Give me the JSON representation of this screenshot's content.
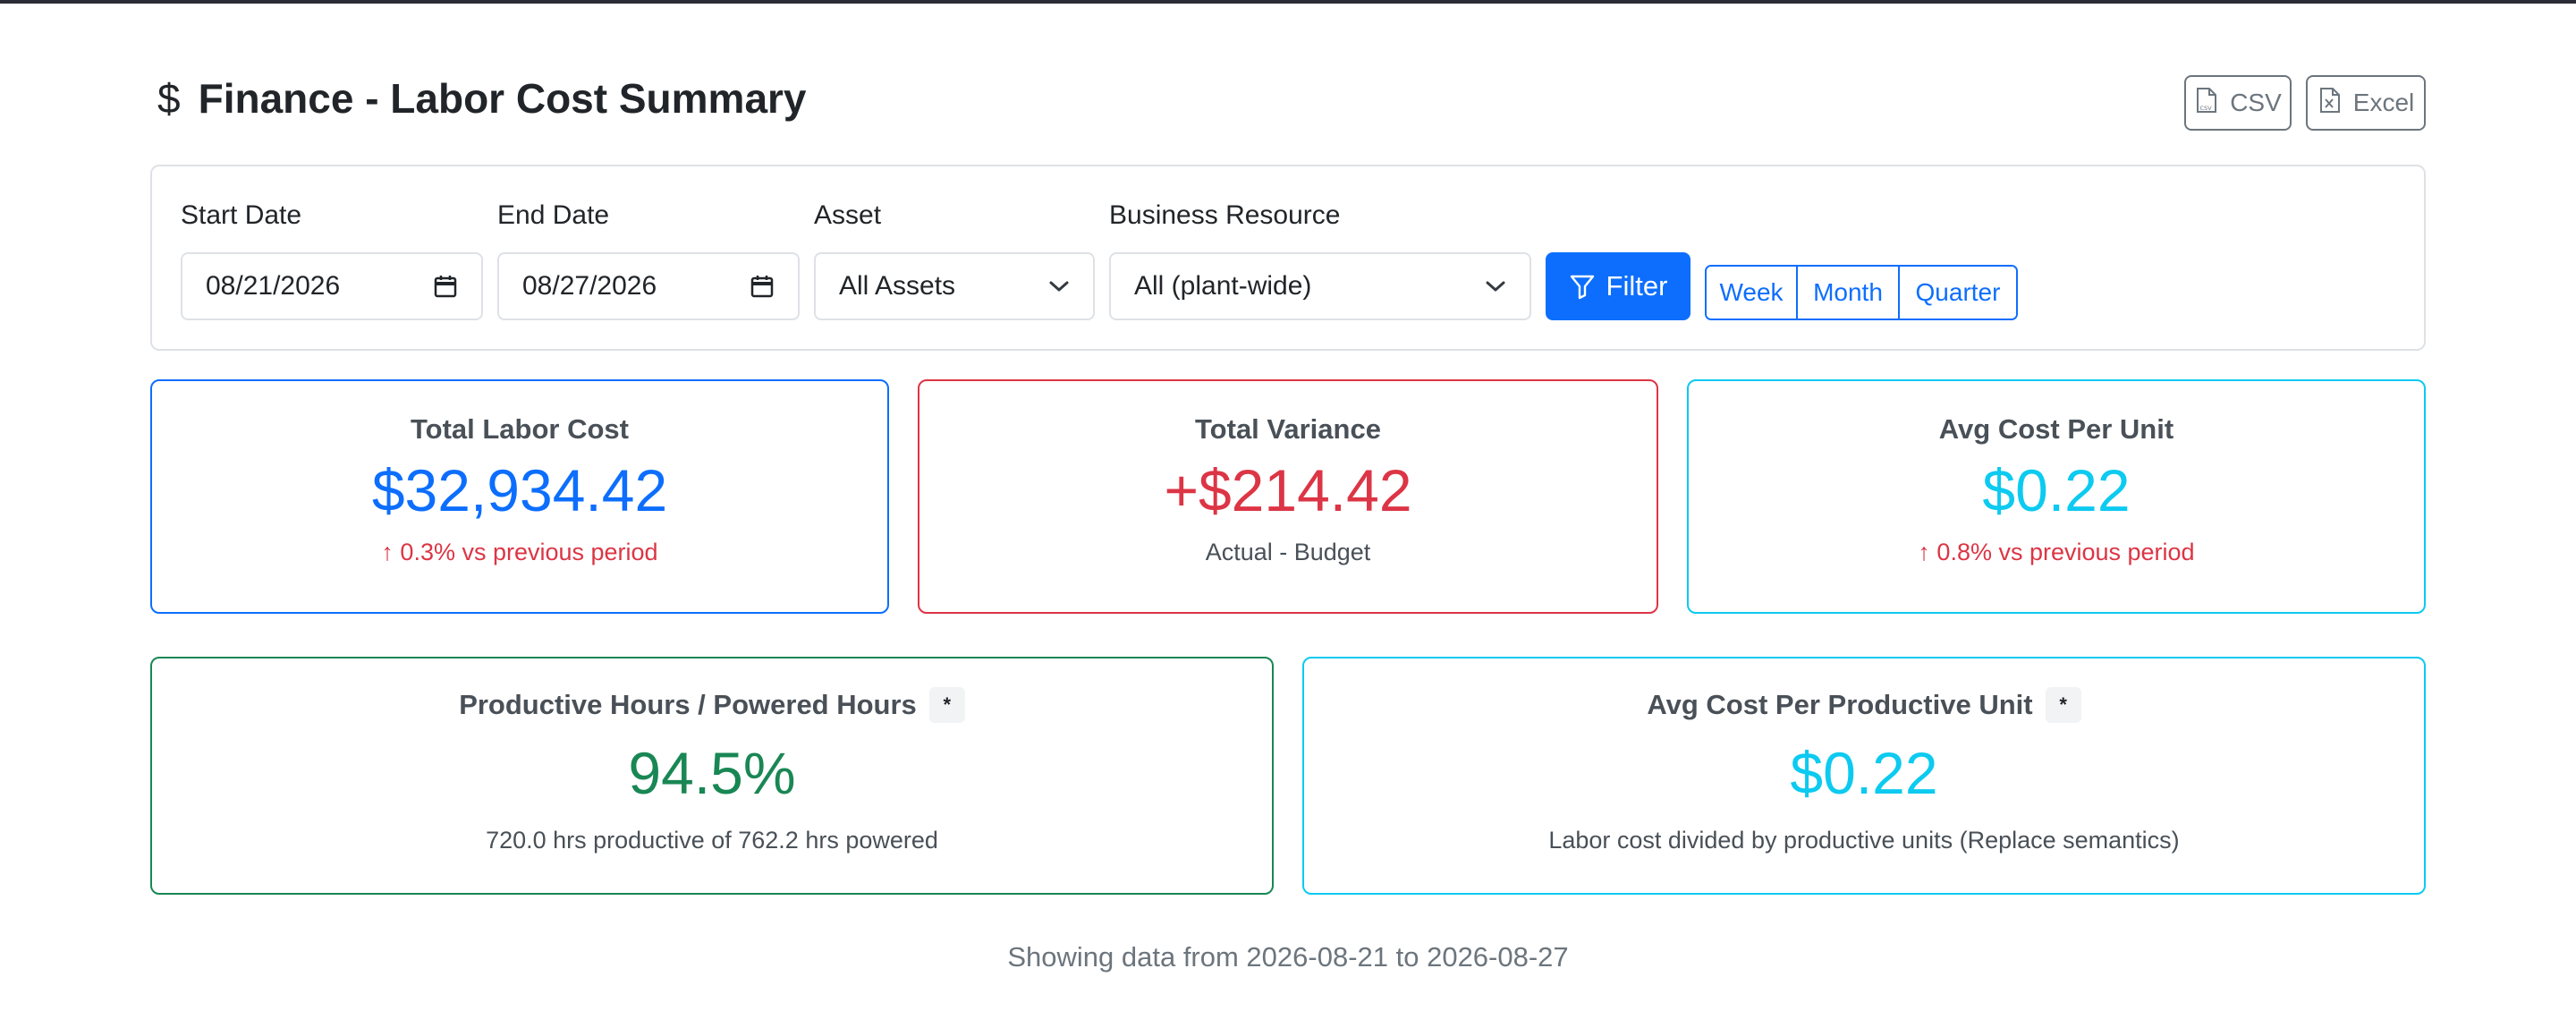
{
  "header": {
    "currency_icon": "$",
    "title": "Finance - Labor Cost Summary",
    "export": {
      "csv_label": "CSV",
      "csv_icon": "file-csv-icon",
      "excel_label": "Excel",
      "excel_icon": "file-excel-icon"
    }
  },
  "filters": {
    "start_date": {
      "label": "Start Date",
      "value": "08/21/2026"
    },
    "end_date": {
      "label": "End Date",
      "value": "08/27/2026"
    },
    "asset": {
      "label": "Asset",
      "value": "All Assets"
    },
    "business_resource": {
      "label": "Business Resource",
      "value": "All (plant-wide)"
    },
    "filter_button": "Filter",
    "ranges": [
      "Week",
      "Month",
      "Quarter"
    ]
  },
  "stats": {
    "total_labor_cost": {
      "title": "Total Labor Cost",
      "value": "$32,934.42",
      "sub": "↑ 0.3% vs previous period"
    },
    "total_variance": {
      "title": "Total Variance",
      "value": "+$214.42",
      "sub": "Actual - Budget"
    },
    "avg_cost_per_unit": {
      "title": "Avg Cost Per Unit",
      "value": "$0.22",
      "sub": "↑ 0.8% vs previous period"
    },
    "productive_ratio": {
      "title": "Productive Hours / Powered Hours",
      "badge": "*",
      "value": "94.5%",
      "sub": "720.0 hrs productive of 762.2 hrs powered"
    },
    "avg_cost_productive_unit": {
      "title": "Avg Cost Per Productive Unit",
      "badge": "*",
      "value": "$0.22",
      "sub": "Labor cost divided by productive units (Replace semantics)"
    }
  },
  "footer": {
    "note": "Showing data from 2026-08-21 to 2026-08-27"
  },
  "colors": {
    "primary": "#0d6efd",
    "danger": "#dc3545",
    "info": "#0dcaf0",
    "success": "#198754",
    "secondary": "#6c757d"
  }
}
